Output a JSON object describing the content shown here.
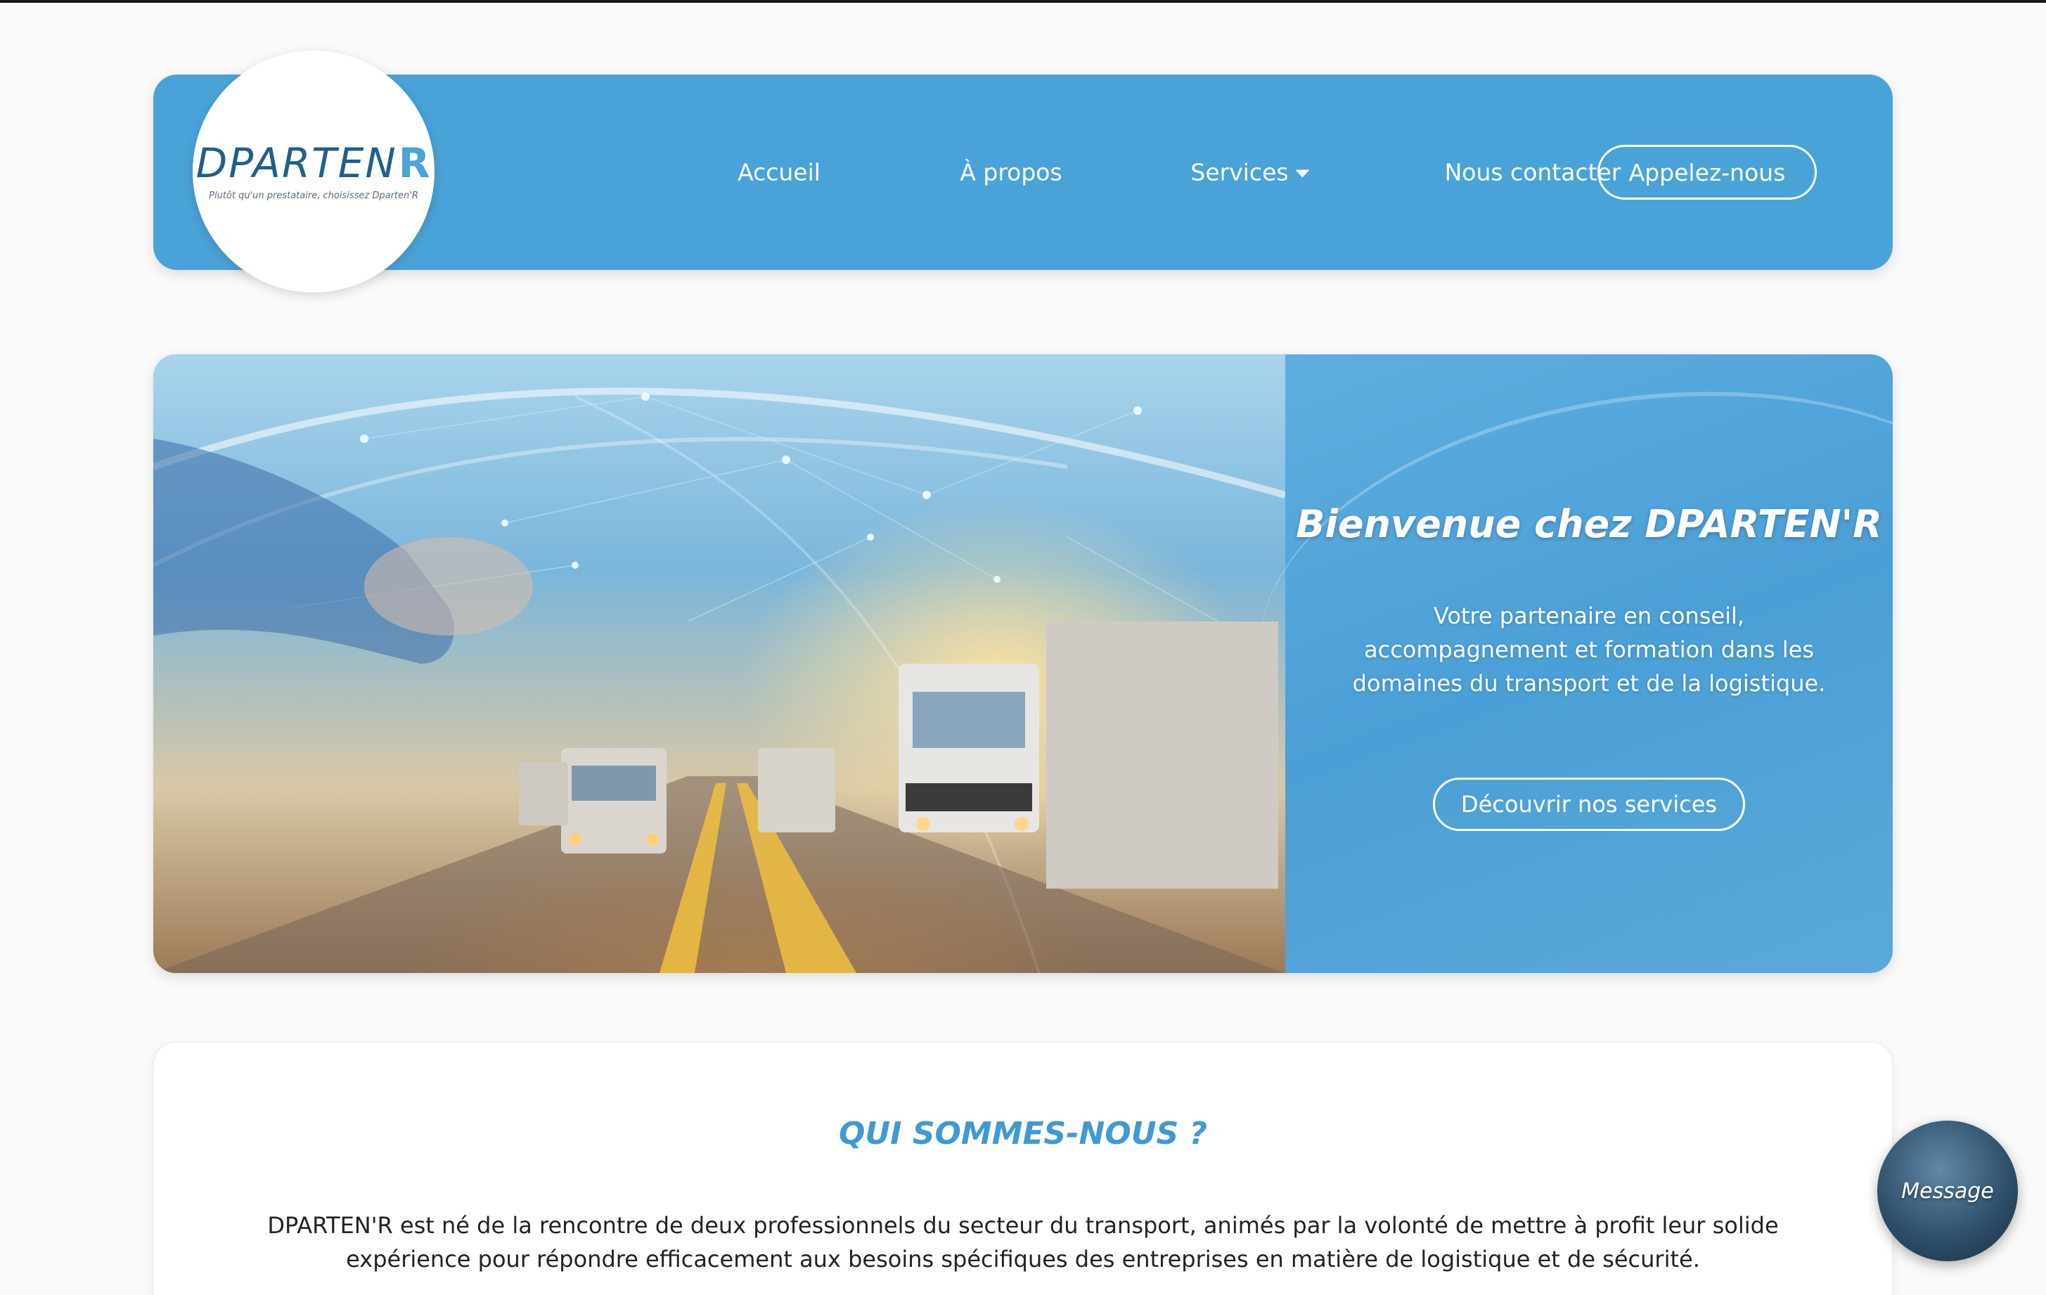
{
  "logo": {
    "wordmark": "DPARTEN",
    "wordmark_r": "R",
    "tagline": "Plutôt qu'un prestataire, choisissez Dparten'R"
  },
  "nav": {
    "home": "Accueil",
    "about": "À propos",
    "services": "Services",
    "contact": "Nous contacter",
    "call_button": "Appelez-nous"
  },
  "hero": {
    "title": "Bienvenue chez DPARTEN'R",
    "subtitle": "Votre partenaire en conseil, accompagnement et formation dans les domaines du transport et de la logistique.",
    "button": "Découvrir nos services"
  },
  "about": {
    "title": "QUI SOMMES-NOUS ?",
    "text": "DPARTEN'R est né de la rencontre de deux professionnels du secteur du transport, animés par la volonté de mettre à profit leur solide expérience pour répondre efficacement aux besoins spécifiques des entreprises en matière de logistique et de sécurité."
  },
  "chat": {
    "label": "Message"
  },
  "colors": {
    "brand_blue": "#4aa3d8",
    "title_blue": "#3e9ad3",
    "logo_navy": "#1f5f8b"
  },
  "icons": {
    "services_caret": "caret-down-icon"
  }
}
